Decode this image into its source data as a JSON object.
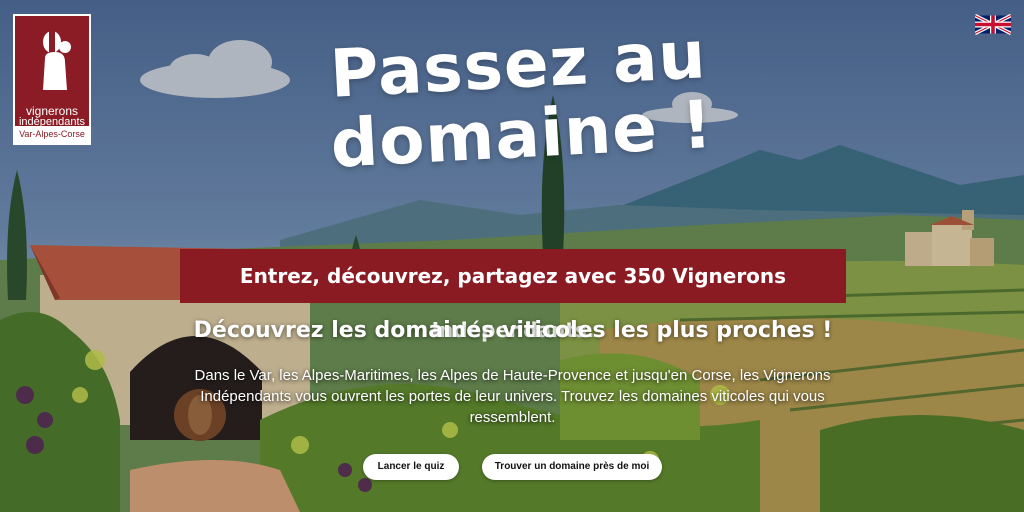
{
  "logo": {
    "line1": "vignerons",
    "line2": "indépendants",
    "region": "Var-Alpes-Corse"
  },
  "language_switch": {
    "icon": "uk-flag-icon"
  },
  "hero": {
    "headline_line1": "Passez au",
    "headline_line2": "domaine !",
    "banner": "Entrez, découvrez, partagez avec 350 Vignerons Indépendants.",
    "subtitle": "Découvrez les domaines viticoles les plus proches !",
    "paragraph": "Dans le Var, les Alpes-Maritimes, les Alpes de Haute-Provence et jusqu'en Corse, les Vignerons Indépendants vous ouvrent les portes de leur univers. Trouvez les domaines viticoles qui vous ressemblent."
  },
  "buttons": {
    "quiz": "Lancer le quiz",
    "find": "Trouver un domaine près de moi"
  },
  "colors": {
    "brand": "#8b1b24",
    "sky": "#5d7aa3",
    "button_bg": "#ffffff"
  }
}
